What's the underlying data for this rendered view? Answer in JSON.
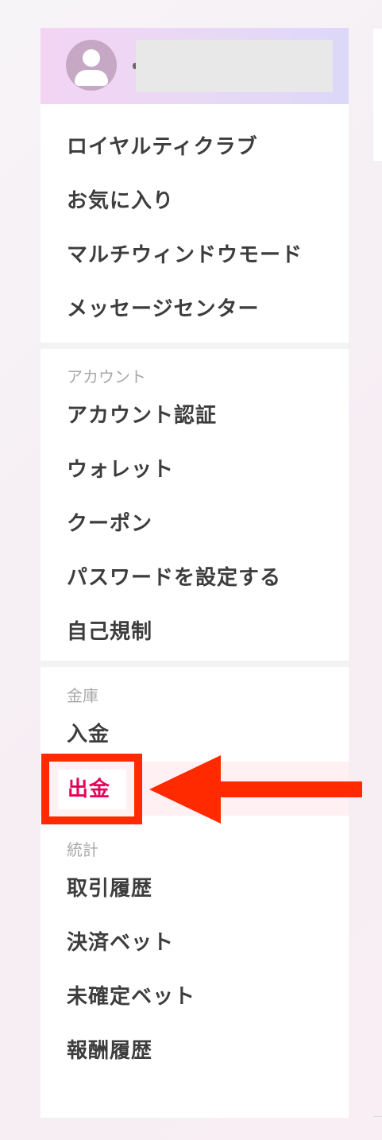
{
  "profile": {
    "username": ""
  },
  "menu_top": [
    {
      "label": "ロイヤルティクラブ"
    },
    {
      "label": "お気に入り"
    },
    {
      "label": "マルチウィンドウモード"
    },
    {
      "label": "メッセージセンター"
    }
  ],
  "account": {
    "heading": "アカウント",
    "items": [
      {
        "label": "アカウント認証"
      },
      {
        "label": "ウォレット"
      },
      {
        "label": "クーポン"
      },
      {
        "label": "パスワードを設定する"
      },
      {
        "label": "自己規制"
      }
    ]
  },
  "vault": {
    "heading": "金庫",
    "items": [
      {
        "label": "入金"
      },
      {
        "label": "出金",
        "active": true
      }
    ]
  },
  "stats": {
    "heading": "統計",
    "items": [
      {
        "label": "取引履歴"
      },
      {
        "label": "決済ベット"
      },
      {
        "label": "未確定ベット"
      },
      {
        "label": "報酬履歴"
      }
    ]
  },
  "colors": {
    "accent": "#e8005a",
    "annotation": "#ff2a00"
  }
}
